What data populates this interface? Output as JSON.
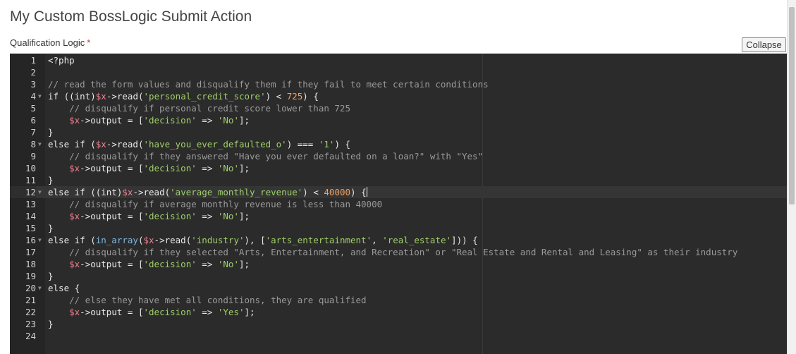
{
  "page": {
    "title": "My Custom BossLogic Submit Action"
  },
  "field": {
    "label": "Qualification Logic",
    "required_mark": "*",
    "collapse_label": "Collapse"
  },
  "editor": {
    "active_line": 12,
    "lines": [
      {
        "n": "1",
        "fold": false,
        "tokens": [
          [
            "kw",
            "<?php"
          ]
        ]
      },
      {
        "n": "2",
        "fold": false,
        "tokens": []
      },
      {
        "n": "3",
        "fold": false,
        "tokens": [
          [
            "cm",
            "// read the form values and disqualify them if they fail to meet certain conditions"
          ]
        ]
      },
      {
        "n": "4",
        "fold": true,
        "tokens": [
          [
            "kw",
            "if (("
          ],
          [
            "kw",
            "int"
          ],
          [
            "kw",
            ")"
          ],
          [
            "var",
            "$x"
          ],
          [
            "op",
            "->"
          ],
          [
            "kw",
            "read("
          ],
          [
            "str",
            "'personal_credit_score'"
          ],
          [
            "kw",
            ") < "
          ],
          [
            "num",
            "725"
          ],
          [
            "kw",
            ") {"
          ]
        ]
      },
      {
        "n": "5",
        "fold": false,
        "tokens": [
          [
            "kw",
            "    "
          ],
          [
            "cm",
            "// disqualify if personal credit score lower than 725"
          ]
        ]
      },
      {
        "n": "6",
        "fold": false,
        "tokens": [
          [
            "kw",
            "    "
          ],
          [
            "var",
            "$x"
          ],
          [
            "op",
            "->"
          ],
          [
            "kw",
            "output = ["
          ],
          [
            "str",
            "'decision'"
          ],
          [
            "kw",
            " => "
          ],
          [
            "str",
            "'No'"
          ],
          [
            "kw",
            "];"
          ]
        ]
      },
      {
        "n": "7",
        "fold": false,
        "tokens": [
          [
            "kw",
            "}"
          ]
        ]
      },
      {
        "n": "8",
        "fold": true,
        "tokens": [
          [
            "kw",
            "else if ("
          ],
          [
            "var",
            "$x"
          ],
          [
            "op",
            "->"
          ],
          [
            "kw",
            "read("
          ],
          [
            "str",
            "'have_you_ever_defaulted_o'"
          ],
          [
            "kw",
            ") === "
          ],
          [
            "str",
            "'1'"
          ],
          [
            "kw",
            ") {"
          ]
        ]
      },
      {
        "n": "9",
        "fold": false,
        "tokens": [
          [
            "kw",
            "    "
          ],
          [
            "cm",
            "// disqualify if they answered \"Have you ever defaulted on a loan?\" with \"Yes\""
          ]
        ]
      },
      {
        "n": "10",
        "fold": false,
        "tokens": [
          [
            "kw",
            "    "
          ],
          [
            "var",
            "$x"
          ],
          [
            "op",
            "->"
          ],
          [
            "kw",
            "output = ["
          ],
          [
            "str",
            "'decision'"
          ],
          [
            "kw",
            " => "
          ],
          [
            "str",
            "'No'"
          ],
          [
            "kw",
            "];"
          ]
        ]
      },
      {
        "n": "11",
        "fold": false,
        "tokens": [
          [
            "kw",
            "}"
          ]
        ]
      },
      {
        "n": "12",
        "fold": true,
        "tokens": [
          [
            "kw",
            "else if (("
          ],
          [
            "kw",
            "int"
          ],
          [
            "kw",
            ")"
          ],
          [
            "var",
            "$x"
          ],
          [
            "op",
            "->"
          ],
          [
            "kw",
            "read("
          ],
          [
            "str",
            "'average_monthly_revenue'"
          ],
          [
            "kw",
            ") < "
          ],
          [
            "num",
            "40000"
          ],
          [
            "kw",
            ") {"
          ]
        ],
        "cursor": true
      },
      {
        "n": "13",
        "fold": false,
        "tokens": [
          [
            "kw",
            "    "
          ],
          [
            "cm",
            "// disqualify if average monthly revenue is less than 40000"
          ]
        ]
      },
      {
        "n": "14",
        "fold": false,
        "tokens": [
          [
            "kw",
            "    "
          ],
          [
            "var",
            "$x"
          ],
          [
            "op",
            "->"
          ],
          [
            "kw",
            "output = ["
          ],
          [
            "str",
            "'decision'"
          ],
          [
            "kw",
            " => "
          ],
          [
            "str",
            "'No'"
          ],
          [
            "kw",
            "];"
          ]
        ]
      },
      {
        "n": "15",
        "fold": false,
        "tokens": [
          [
            "kw",
            "}"
          ]
        ]
      },
      {
        "n": "16",
        "fold": true,
        "tokens": [
          [
            "kw",
            "else if ("
          ],
          [
            "fn",
            "in_array"
          ],
          [
            "kw",
            "("
          ],
          [
            "var",
            "$x"
          ],
          [
            "op",
            "->"
          ],
          [
            "kw",
            "read("
          ],
          [
            "str",
            "'industry'"
          ],
          [
            "kw",
            "), ["
          ],
          [
            "str",
            "'arts_entertainment'"
          ],
          [
            "kw",
            ", "
          ],
          [
            "str",
            "'real_estate'"
          ],
          [
            "kw",
            "])) {"
          ]
        ]
      },
      {
        "n": "17",
        "fold": false,
        "tokens": [
          [
            "kw",
            "    "
          ],
          [
            "cm",
            "// disqualify if they selected \"Arts, Entertainment, and Recreation\" or \"Real Estate and Rental and Leasing\" as their industry"
          ]
        ]
      },
      {
        "n": "18",
        "fold": false,
        "tokens": [
          [
            "kw",
            "    "
          ],
          [
            "var",
            "$x"
          ],
          [
            "op",
            "->"
          ],
          [
            "kw",
            "output = ["
          ],
          [
            "str",
            "'decision'"
          ],
          [
            "kw",
            " => "
          ],
          [
            "str",
            "'No'"
          ],
          [
            "kw",
            "];"
          ]
        ]
      },
      {
        "n": "19",
        "fold": false,
        "tokens": [
          [
            "kw",
            "}"
          ]
        ]
      },
      {
        "n": "20",
        "fold": true,
        "tokens": [
          [
            "kw",
            "else {"
          ]
        ]
      },
      {
        "n": "21",
        "fold": false,
        "tokens": [
          [
            "kw",
            "    "
          ],
          [
            "cm",
            "// else they have met all conditions, they are qualified"
          ]
        ]
      },
      {
        "n": "22",
        "fold": false,
        "tokens": [
          [
            "kw",
            "    "
          ],
          [
            "var",
            "$x"
          ],
          [
            "op",
            "->"
          ],
          [
            "kw",
            "output = ["
          ],
          [
            "str",
            "'decision'"
          ],
          [
            "kw",
            " => "
          ],
          [
            "str",
            "'Yes'"
          ],
          [
            "kw",
            "];"
          ]
        ]
      },
      {
        "n": "23",
        "fold": false,
        "tokens": [
          [
            "kw",
            "}"
          ]
        ]
      },
      {
        "n": "24",
        "fold": false,
        "tokens": []
      }
    ]
  },
  "icons": {
    "fold": "chevron-down-icon"
  }
}
